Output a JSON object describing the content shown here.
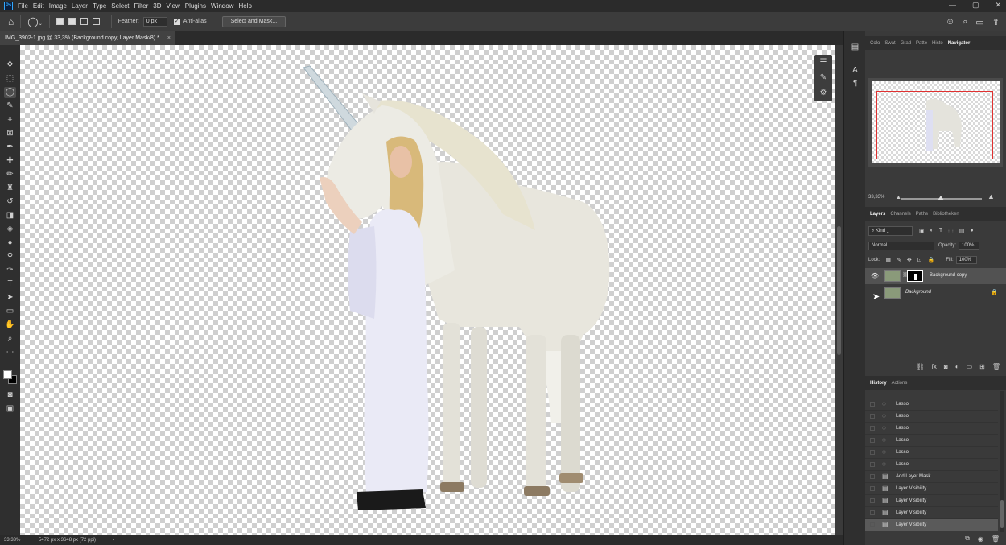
{
  "app": {
    "logo": "Ps"
  },
  "menu": [
    "File",
    "Edit",
    "Image",
    "Layer",
    "Type",
    "Select",
    "Filter",
    "3D",
    "View",
    "Plugins",
    "Window",
    "Help"
  ],
  "window_controls": {
    "minimize": "—",
    "maximize": "▢",
    "close": "✕"
  },
  "options_bar": {
    "feather_label": "Feather:",
    "feather_value": "0 px",
    "antialias_label": "Anti-alias",
    "select_mask_button": "Select and Mask..."
  },
  "document_tab": {
    "title": "IMG_3902-1.jpg @ 33,3% (Background copy, Layer Mask/8) *",
    "close": "×"
  },
  "status_bar": {
    "zoom": "33,33%",
    "info": "5472 px x 3648 px (72 ppi)",
    "arrow": "›"
  },
  "panel_tabs_top": [
    "Colo",
    "Swat",
    "Grad",
    "Patte",
    "Histo",
    "Navigator"
  ],
  "navigator": {
    "zoom": "33,33%"
  },
  "layers_tabs": [
    "Layers",
    "Channels",
    "Paths",
    "Bibliotheken"
  ],
  "layers_panel": {
    "kind_label": "Kind",
    "blend_mode": "Normal",
    "opacity_label": "Opacity:",
    "opacity_value": "100%",
    "lock_label": "Lock:",
    "fill_label": "Fill:",
    "fill_value": "100%",
    "layers": [
      {
        "name": "Background copy",
        "visible": true,
        "has_mask": true,
        "selected": true
      },
      {
        "name": "Background",
        "visible": false,
        "locked": true,
        "selected": false
      }
    ]
  },
  "history_tabs": [
    "History",
    "Actions"
  ],
  "history": [
    {
      "label": "Lasso",
      "icon": "lasso-icon"
    },
    {
      "label": "Lasso",
      "icon": "lasso-icon"
    },
    {
      "label": "Lasso",
      "icon": "lasso-icon"
    },
    {
      "label": "Lasso",
      "icon": "lasso-icon"
    },
    {
      "label": "Lasso",
      "icon": "lasso-icon"
    },
    {
      "label": "Lasso",
      "icon": "lasso-icon"
    },
    {
      "label": "Add Layer Mask",
      "icon": "document-icon"
    },
    {
      "label": "Layer Visibility",
      "icon": "document-icon"
    },
    {
      "label": "Layer Visibility",
      "icon": "document-icon"
    },
    {
      "label": "Layer Visibility",
      "icon": "document-icon"
    },
    {
      "label": "Layer Visibility",
      "icon": "document-icon",
      "current": true
    }
  ],
  "colors": {
    "foreground": "#ffffff",
    "background": "#000000",
    "navigator_frame": "#e03030"
  }
}
